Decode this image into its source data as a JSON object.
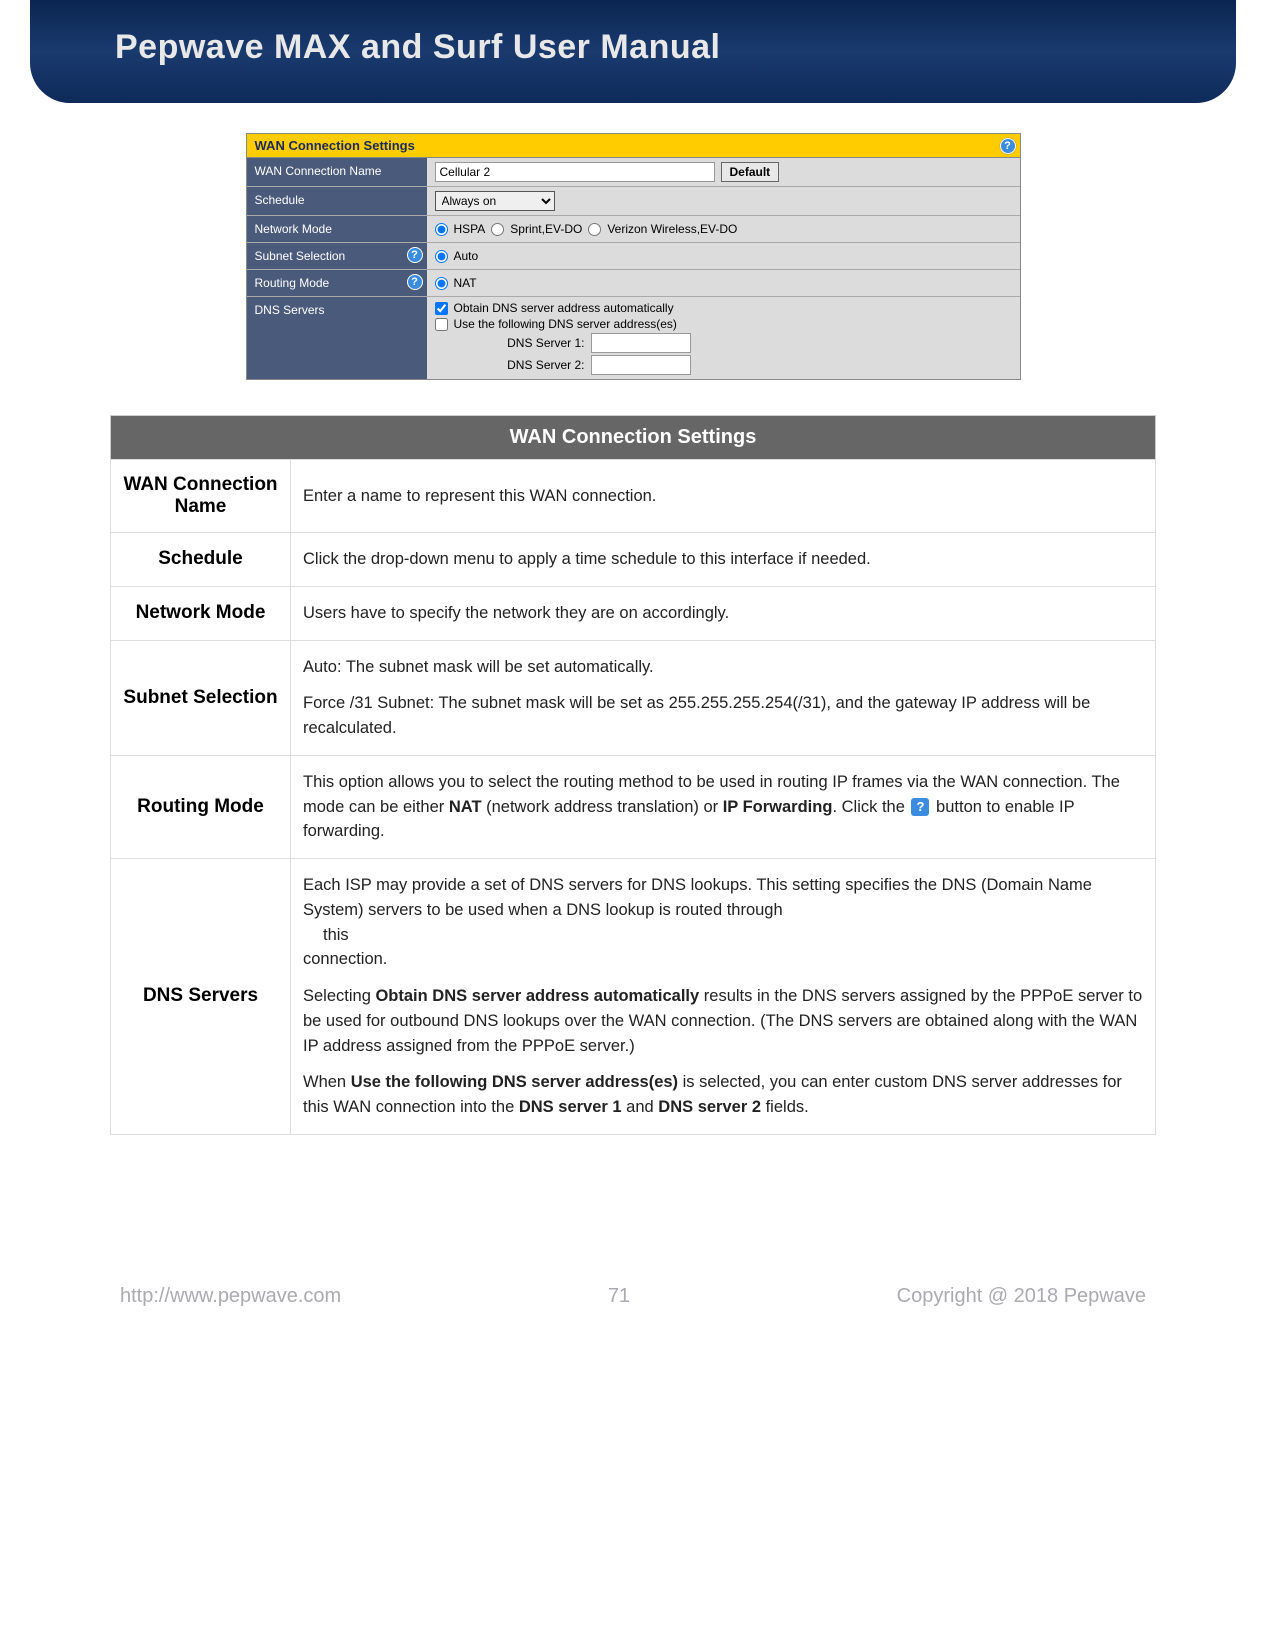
{
  "header": {
    "title": "Pepwave MAX and Surf User Manual"
  },
  "panel": {
    "title": "WAN Connection Settings",
    "rows": {
      "name_label": "WAN Connection Name",
      "name_value": "Cellular 2",
      "default_btn": "Default",
      "schedule_label": "Schedule",
      "schedule_value": "Always on",
      "network_label": "Network Mode",
      "net_opt1": "HSPA",
      "net_opt2": "Sprint,EV-DO",
      "net_opt3": "Verizon Wireless,EV-DO",
      "subnet_label": "Subnet Selection",
      "subnet_opt": "Auto",
      "routing_label": "Routing Mode",
      "routing_opt": "NAT",
      "dns_label": "DNS Servers",
      "dns_auto": "Obtain DNS server address automatically",
      "dns_manual": "Use the following DNS server address(es)",
      "dns1_label": "DNS Server 1:",
      "dns2_label": "DNS Server 2:"
    }
  },
  "table": {
    "header": "WAN Connection Settings",
    "r1_term": "WAN Connection Name",
    "r1_def": "Enter a name to represent this WAN connection.",
    "r2_term": "Schedule",
    "r2_def": "Click the drop-down menu to apply a time schedule to this interface if needed.",
    "r3_term": "Network Mode",
    "r3_def": "Users have to specify the network they are on accordingly.",
    "r4_term": "Subnet Selection",
    "r4_def_a": "Auto: The subnet mask will be set automatically.",
    "r4_def_b": "Force /31 Subnet: The subnet mask will be set as 255.255.255.254(/31), and the gateway IP address will be recalculated.",
    "r5_term": "Routing Mode",
    "r5_a": "This option allows you to select the routing method to be used in routing IP frames via the WAN connection. The mode can be either ",
    "r5_nat": "NAT",
    "r5_b": " (network address translation) or ",
    "r5_ipf": "IP Forwarding",
    "r5_c": ". Click the ",
    "r5_d": " button to enable IP forwarding.",
    "r6_term": "DNS Servers",
    "r6_p1a": "Each ISP may provide a set of DNS servers for DNS lookups. This setting specifies the DNS (Domain Name System) servers to be used when a DNS lookup is routed through",
    "r6_p1b": "this",
    "r6_p1c": "connection.",
    "r6_p2a": "Selecting ",
    "r6_p2bold": "Obtain DNS server address automatically",
    "r6_p2b": " results in the DNS servers assigned by the PPPoE server to be used for outbound DNS lookups over the WAN connection. (The DNS servers are obtained along with the WAN IP address assigned from the PPPoE server.)",
    "r6_p3a": "When ",
    "r6_p3bold": "Use the following DNS server address(es)",
    "r6_p3b": " is selected, you can enter custom DNS server addresses for this WAN connection into the ",
    "r6_p3c": "DNS server 1",
    "r6_p3d": " and ",
    "r6_p3e": "DNS server 2",
    "r6_p3f": " fields."
  },
  "footer": {
    "url": "http://www.pepwave.com",
    "page": "71",
    "copyright": "Copyright @ 2018 Pepwave"
  }
}
